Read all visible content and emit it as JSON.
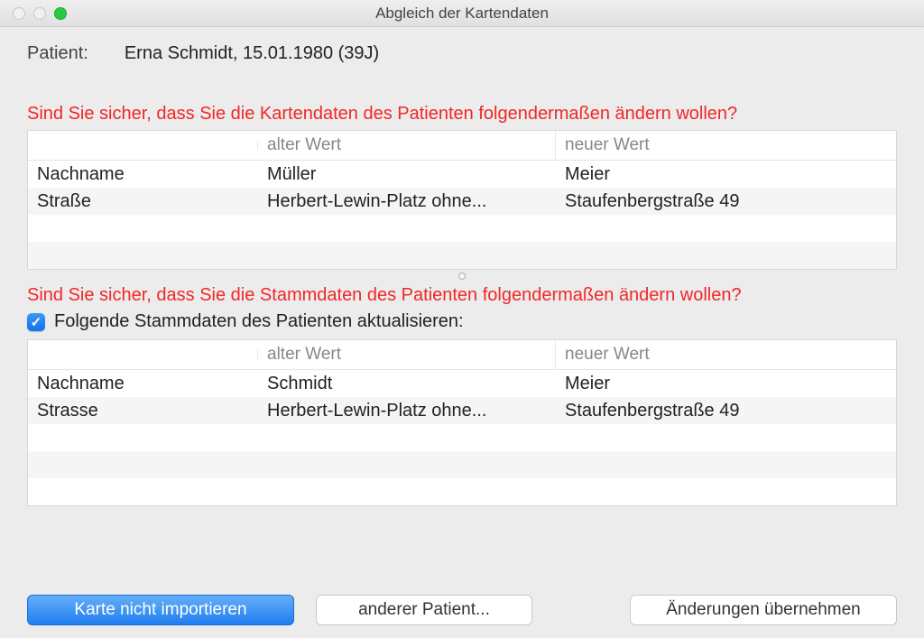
{
  "window": {
    "title": "Abgleich der Kartendaten"
  },
  "patient": {
    "label": "Patient:",
    "value": "Erna Schmidt, 15.01.1980 (39J)"
  },
  "kartendaten": {
    "warning": "Sind Sie sicher, dass Sie die Kartendaten des Patienten folgendermaßen ändern wollen?",
    "headers": {
      "field": "",
      "old": "alter Wert",
      "new": "neuer Wert"
    },
    "rows": [
      {
        "field": "Nachname",
        "old": "Müller",
        "new": "Meier"
      },
      {
        "field": "Straße",
        "old": "Herbert-Lewin-Platz ohne...",
        "new": "Staufenbergstraße 49"
      }
    ]
  },
  "stammdaten": {
    "warning": "Sind Sie sicher, dass Sie die Stammdaten des Patienten folgendermaßen ändern wollen?",
    "checkbox_label": "Folgende Stammdaten des Patienten aktualisieren:",
    "checkbox_checked": true,
    "headers": {
      "field": "",
      "old": "alter Wert",
      "new": "neuer Wert"
    },
    "rows": [
      {
        "field": "Nachname",
        "old": "Schmidt",
        "new": "Meier"
      },
      {
        "field": "Strasse",
        "old": "Herbert-Lewin-Platz ohne...",
        "new": "Staufenbergstraße 49"
      }
    ]
  },
  "buttons": {
    "dont_import": "Karte nicht importieren",
    "other_patient": "anderer Patient...",
    "apply": "Änderungen übernehmen"
  }
}
